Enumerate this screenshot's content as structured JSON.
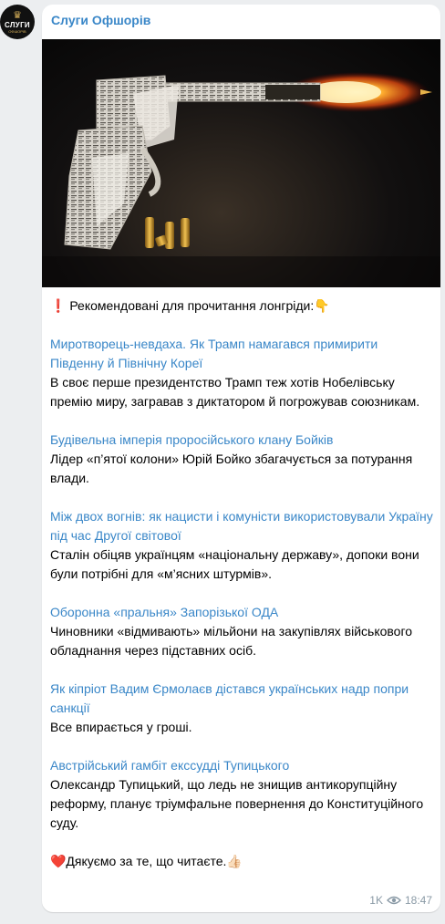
{
  "channel": {
    "name": "Слуги Офшорів",
    "avatar_text": "СЛУГИ",
    "avatar_subtext": "ОФШОРІВ"
  },
  "post": {
    "intro": "❗️ Рекомендовані для прочитання лонгріди:👇",
    "articles": [
      {
        "title": "Миротворець-невдаха. Як Трамп намагався примирити Південну й Північну Кореї",
        "desc": "В своє перше президентство Трамп теж хотів Нобелівську премію миру, загравав з диктатором й погрожував союзникам."
      },
      {
        "title": "Будівельна імперія проросійського клану Бойків",
        "desc": "Лідер «п’ятої колони» Юрій Бойко збагачується за потурання влади."
      },
      {
        "title": "Між двох вогнів: як нацисти і комуністи використовували Україну під час Другої світової",
        "desc": "Сталін обіцяв українцям «національну державу», допоки вони були потрібні для «м’ясних штурмів»."
      },
      {
        "title": "Оборонна «пральня» Запорізької ОДА",
        "desc": "Чиновники «відмивають» мільйони на закупівлях військового обладнання через підставних осіб."
      },
      {
        "title": "Як кіпріот Вадим Єрмолаєв дістався українських надр попри санкції",
        "desc": "Все впирається у гроші."
      },
      {
        "title": "Австрійський гамбіт екссудді Тупицького",
        "desc": "Олександр Тупицький, що ледь не знищив антикорупційну реформу, планує тріумфальне повернення до Конституційного суду."
      }
    ],
    "outro": "❤️Дякуємо за те, що читаєте.👍🏻",
    "views": "1K",
    "time": "18:47"
  },
  "colors": {
    "background": "#eceef0",
    "bubble": "#ffffff",
    "link": "#3a87c8",
    "meta": "#8a9aa6"
  },
  "icons": [
    "eye-icon",
    "crown-icon"
  ]
}
